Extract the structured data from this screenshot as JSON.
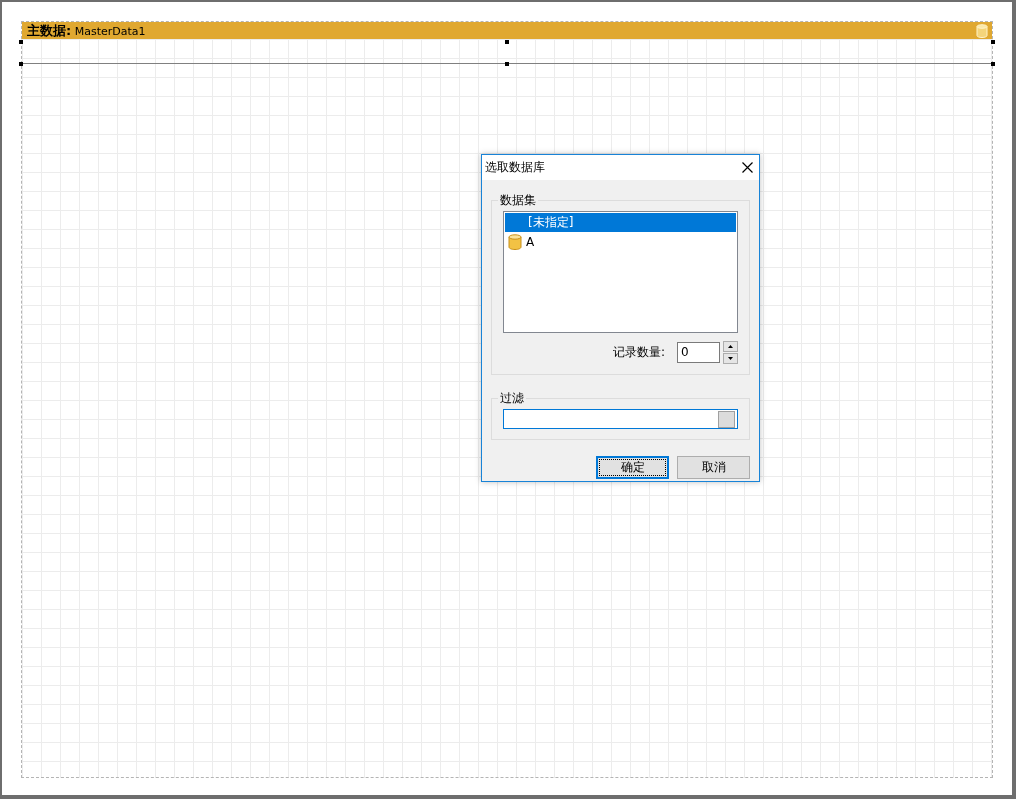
{
  "band": {
    "title": "**主数据:** MasterData1"
  },
  "dialog": {
    "title": "选取数据库",
    "dataset_group": {
      "label": "数据集",
      "items": [
        {
          "label": "[未指定]",
          "kind": "none",
          "selected": true
        },
        {
          "label": "A",
          "kind": "database",
          "selected": false
        }
      ],
      "record_count_label": "记录数量:",
      "record_count": "0"
    },
    "filter_group": {
      "label": "过滤"
    },
    "buttons": [
      {
        "label": "确定",
        "default": true
      },
      {
        "label": "取消",
        "default": false
      }
    ]
  }
}
